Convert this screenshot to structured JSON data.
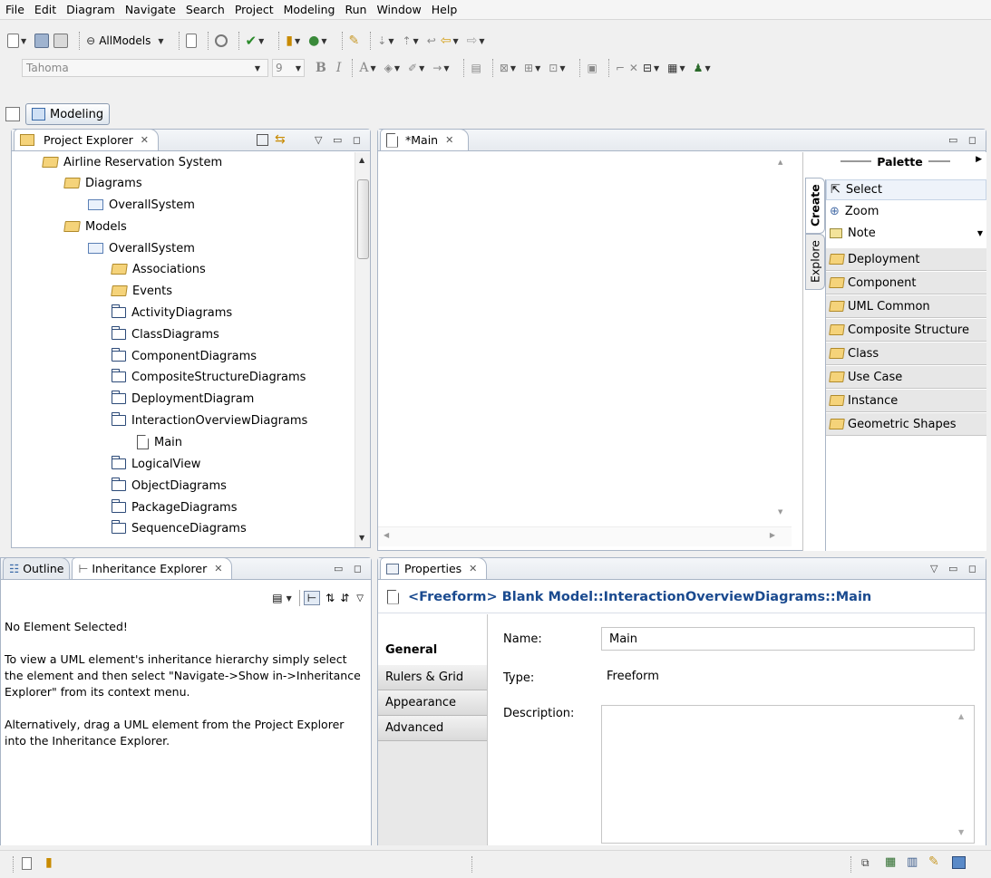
{
  "menu": [
    "File",
    "Edit",
    "Diagram",
    "Navigate",
    "Search",
    "Project",
    "Modeling",
    "Run",
    "Window",
    "Help"
  ],
  "toolbar": {
    "models_label": "AllModels",
    "font_name": "Tahoma",
    "font_size": "9",
    "bold": "B",
    "italic": "I",
    "text_color": "A"
  },
  "perspective": {
    "label": "Modeling"
  },
  "project_explorer": {
    "title": "Project Explorer",
    "items": [
      {
        "label": "Airline Reservation System",
        "icon": "open-folder-icon"
      },
      {
        "label": "Diagrams",
        "icon": "diagrams-folder-icon"
      },
      {
        "label": "OverallSystem",
        "icon": "diagram-icon"
      },
      {
        "label": "Models",
        "icon": "models-folder-icon"
      },
      {
        "label": "OverallSystem",
        "icon": "diagram-icon"
      },
      {
        "label": "Associations",
        "icon": "associations-folder-icon"
      },
      {
        "label": "Events",
        "icon": "events-folder-icon"
      },
      {
        "label": "ActivityDiagrams",
        "icon": "folder-icon"
      },
      {
        "label": "ClassDiagrams",
        "icon": "folder-icon"
      },
      {
        "label": "ComponentDiagrams",
        "icon": "folder-icon"
      },
      {
        "label": "CompositeStructureDiagrams",
        "icon": "folder-icon"
      },
      {
        "label": "DeploymentDiagram",
        "icon": "folder-icon"
      },
      {
        "label": "InteractionOverviewDiagrams",
        "icon": "folder-icon"
      },
      {
        "label": "Main",
        "icon": "page-icon"
      },
      {
        "label": "LogicalView",
        "icon": "folder-icon"
      },
      {
        "label": "ObjectDiagrams",
        "icon": "folder-icon"
      },
      {
        "label": "PackageDiagrams",
        "icon": "folder-icon"
      },
      {
        "label": "SequenceDiagrams",
        "icon": "folder-icon"
      }
    ]
  },
  "editor": {
    "tab_title": "*Main"
  },
  "palette": {
    "title": "Palette",
    "side_tabs": [
      "Create",
      "Explore"
    ],
    "tools": [
      "Select",
      "Zoom",
      "Note"
    ],
    "drawers": [
      "Deployment",
      "Component",
      "UML Common",
      "Composite Structure",
      "Class",
      "Use Case",
      "Instance",
      "Geometric Shapes"
    ]
  },
  "outline": {
    "tab_outline": "Outline",
    "tab_inheritance": "Inheritance Explorer",
    "message_title": "No Element Selected!",
    "message_body": "To view a UML element's inheritance hierarchy simply select the element and then select \"Navigate->Show in->Inheritance Explorer\" from its context menu.",
    "message_alt": "Alternatively, drag a UML element from the Project Explorer into the Inheritance Explorer."
  },
  "properties": {
    "tab_title": "Properties",
    "header": "<Freeform> Blank Model::InteractionOverviewDiagrams::Main",
    "tabs": [
      "General",
      "Rulers & Grid",
      "Appearance",
      "Advanced"
    ],
    "name_label": "Name:",
    "name_value": "Main",
    "type_label": "Type:",
    "type_value": "Freeform",
    "description_label": "Description:",
    "description_value": ""
  },
  "colors": {
    "accent": "#1a4a8f",
    "panel_border": "#a9b5c6"
  }
}
